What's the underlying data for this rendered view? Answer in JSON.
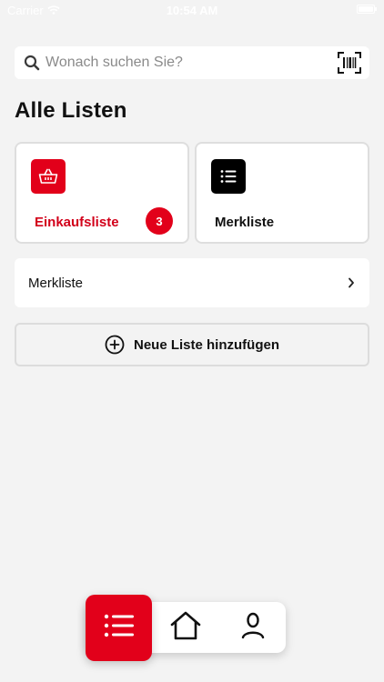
{
  "status_bar": {
    "carrier": "Carrier",
    "time": "10:54 AM"
  },
  "search": {
    "placeholder": "Wonach suchen Sie?",
    "value": ""
  },
  "page_title": "Alle Listen",
  "cards": [
    {
      "label": "Einkaufsliste",
      "badge": "3",
      "icon": "basket-icon",
      "accent": "#e2001a"
    },
    {
      "label": "Merkliste",
      "icon": "list-icon",
      "accent": "#000000"
    }
  ],
  "list_rows": [
    {
      "label": "Merkliste"
    }
  ],
  "add_button": {
    "label": "Neue Liste hinzufügen",
    "icon": "plus-circle-icon"
  },
  "tab_bar": {
    "active": "lists",
    "items": [
      "list-icon",
      "home-icon",
      "profile-icon"
    ]
  },
  "colors": {
    "brand": "#e2001a",
    "background": "#f3f3f3"
  }
}
